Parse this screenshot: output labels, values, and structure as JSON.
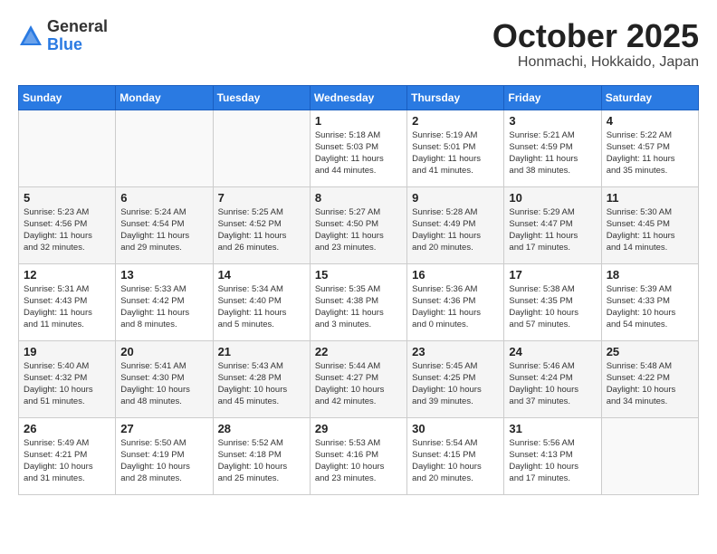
{
  "header": {
    "logo_general": "General",
    "logo_blue": "Blue",
    "month_title": "October 2025",
    "location": "Honmachi, Hokkaido, Japan"
  },
  "days_of_week": [
    "Sunday",
    "Monday",
    "Tuesday",
    "Wednesday",
    "Thursday",
    "Friday",
    "Saturday"
  ],
  "weeks": [
    [
      {
        "num": "",
        "detail": ""
      },
      {
        "num": "",
        "detail": ""
      },
      {
        "num": "",
        "detail": ""
      },
      {
        "num": "1",
        "detail": "Sunrise: 5:18 AM\nSunset: 5:03 PM\nDaylight: 11 hours\nand 44 minutes."
      },
      {
        "num": "2",
        "detail": "Sunrise: 5:19 AM\nSunset: 5:01 PM\nDaylight: 11 hours\nand 41 minutes."
      },
      {
        "num": "3",
        "detail": "Sunrise: 5:21 AM\nSunset: 4:59 PM\nDaylight: 11 hours\nand 38 minutes."
      },
      {
        "num": "4",
        "detail": "Sunrise: 5:22 AM\nSunset: 4:57 PM\nDaylight: 11 hours\nand 35 minutes."
      }
    ],
    [
      {
        "num": "5",
        "detail": "Sunrise: 5:23 AM\nSunset: 4:56 PM\nDaylight: 11 hours\nand 32 minutes."
      },
      {
        "num": "6",
        "detail": "Sunrise: 5:24 AM\nSunset: 4:54 PM\nDaylight: 11 hours\nand 29 minutes."
      },
      {
        "num": "7",
        "detail": "Sunrise: 5:25 AM\nSunset: 4:52 PM\nDaylight: 11 hours\nand 26 minutes."
      },
      {
        "num": "8",
        "detail": "Sunrise: 5:27 AM\nSunset: 4:50 PM\nDaylight: 11 hours\nand 23 minutes."
      },
      {
        "num": "9",
        "detail": "Sunrise: 5:28 AM\nSunset: 4:49 PM\nDaylight: 11 hours\nand 20 minutes."
      },
      {
        "num": "10",
        "detail": "Sunrise: 5:29 AM\nSunset: 4:47 PM\nDaylight: 11 hours\nand 17 minutes."
      },
      {
        "num": "11",
        "detail": "Sunrise: 5:30 AM\nSunset: 4:45 PM\nDaylight: 11 hours\nand 14 minutes."
      }
    ],
    [
      {
        "num": "12",
        "detail": "Sunrise: 5:31 AM\nSunset: 4:43 PM\nDaylight: 11 hours\nand 11 minutes."
      },
      {
        "num": "13",
        "detail": "Sunrise: 5:33 AM\nSunset: 4:42 PM\nDaylight: 11 hours\nand 8 minutes."
      },
      {
        "num": "14",
        "detail": "Sunrise: 5:34 AM\nSunset: 4:40 PM\nDaylight: 11 hours\nand 5 minutes."
      },
      {
        "num": "15",
        "detail": "Sunrise: 5:35 AM\nSunset: 4:38 PM\nDaylight: 11 hours\nand 3 minutes."
      },
      {
        "num": "16",
        "detail": "Sunrise: 5:36 AM\nSunset: 4:36 PM\nDaylight: 11 hours\nand 0 minutes."
      },
      {
        "num": "17",
        "detail": "Sunrise: 5:38 AM\nSunset: 4:35 PM\nDaylight: 10 hours\nand 57 minutes."
      },
      {
        "num": "18",
        "detail": "Sunrise: 5:39 AM\nSunset: 4:33 PM\nDaylight: 10 hours\nand 54 minutes."
      }
    ],
    [
      {
        "num": "19",
        "detail": "Sunrise: 5:40 AM\nSunset: 4:32 PM\nDaylight: 10 hours\nand 51 minutes."
      },
      {
        "num": "20",
        "detail": "Sunrise: 5:41 AM\nSunset: 4:30 PM\nDaylight: 10 hours\nand 48 minutes."
      },
      {
        "num": "21",
        "detail": "Sunrise: 5:43 AM\nSunset: 4:28 PM\nDaylight: 10 hours\nand 45 minutes."
      },
      {
        "num": "22",
        "detail": "Sunrise: 5:44 AM\nSunset: 4:27 PM\nDaylight: 10 hours\nand 42 minutes."
      },
      {
        "num": "23",
        "detail": "Sunrise: 5:45 AM\nSunset: 4:25 PM\nDaylight: 10 hours\nand 39 minutes."
      },
      {
        "num": "24",
        "detail": "Sunrise: 5:46 AM\nSunset: 4:24 PM\nDaylight: 10 hours\nand 37 minutes."
      },
      {
        "num": "25",
        "detail": "Sunrise: 5:48 AM\nSunset: 4:22 PM\nDaylight: 10 hours\nand 34 minutes."
      }
    ],
    [
      {
        "num": "26",
        "detail": "Sunrise: 5:49 AM\nSunset: 4:21 PM\nDaylight: 10 hours\nand 31 minutes."
      },
      {
        "num": "27",
        "detail": "Sunrise: 5:50 AM\nSunset: 4:19 PM\nDaylight: 10 hours\nand 28 minutes."
      },
      {
        "num": "28",
        "detail": "Sunrise: 5:52 AM\nSunset: 4:18 PM\nDaylight: 10 hours\nand 25 minutes."
      },
      {
        "num": "29",
        "detail": "Sunrise: 5:53 AM\nSunset: 4:16 PM\nDaylight: 10 hours\nand 23 minutes."
      },
      {
        "num": "30",
        "detail": "Sunrise: 5:54 AM\nSunset: 4:15 PM\nDaylight: 10 hours\nand 20 minutes."
      },
      {
        "num": "31",
        "detail": "Sunrise: 5:56 AM\nSunset: 4:13 PM\nDaylight: 10 hours\nand 17 minutes."
      },
      {
        "num": "",
        "detail": ""
      }
    ]
  ]
}
